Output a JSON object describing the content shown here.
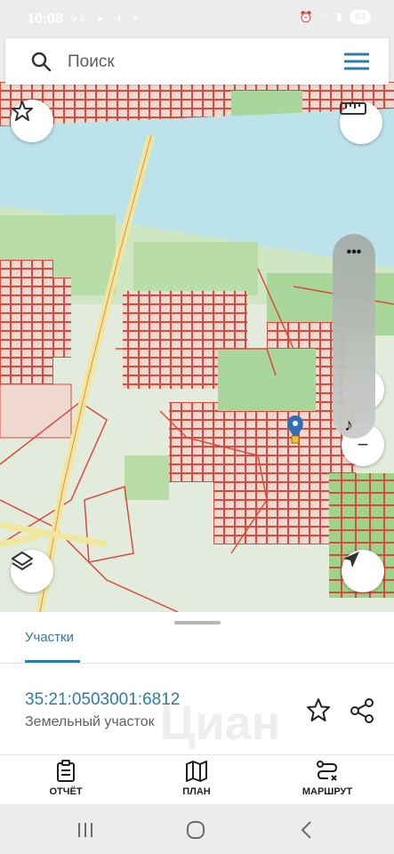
{
  "status_bar": {
    "time": "10:08",
    "left_icons": [
      "vk-icon",
      "telegram-icon",
      "location-icon",
      "dot-icon"
    ],
    "right_icons": [
      "alarm-icon",
      "wifi-icon",
      "signal-icon"
    ],
    "battery": "93"
  },
  "search": {
    "placeholder": "Поиск"
  },
  "map": {
    "zoom_menu": "•••",
    "zoom_note": "♪",
    "colors": {
      "water": "#bde3ea",
      "land": "#dfe9d8",
      "green": "#a9d69a",
      "road": "#f1e79a",
      "parcel": "#d94a3d"
    },
    "marker": "location-pin-icon"
  },
  "sheet": {
    "tab_label": "Участки",
    "parcel_id": "35:21:0503001:6812",
    "parcel_type": "Земельный участок",
    "watermark": "Циан"
  },
  "bottom_nav": {
    "items": [
      {
        "label": "ОТЧЁТ",
        "icon": "clipboard-icon"
      },
      {
        "label": "ПЛАН",
        "icon": "map-icon"
      },
      {
        "label": "МАРШРУТ",
        "icon": "route-icon"
      }
    ]
  },
  "system_nav": {
    "buttons": [
      "recents-icon",
      "home-icon",
      "back-icon"
    ]
  }
}
